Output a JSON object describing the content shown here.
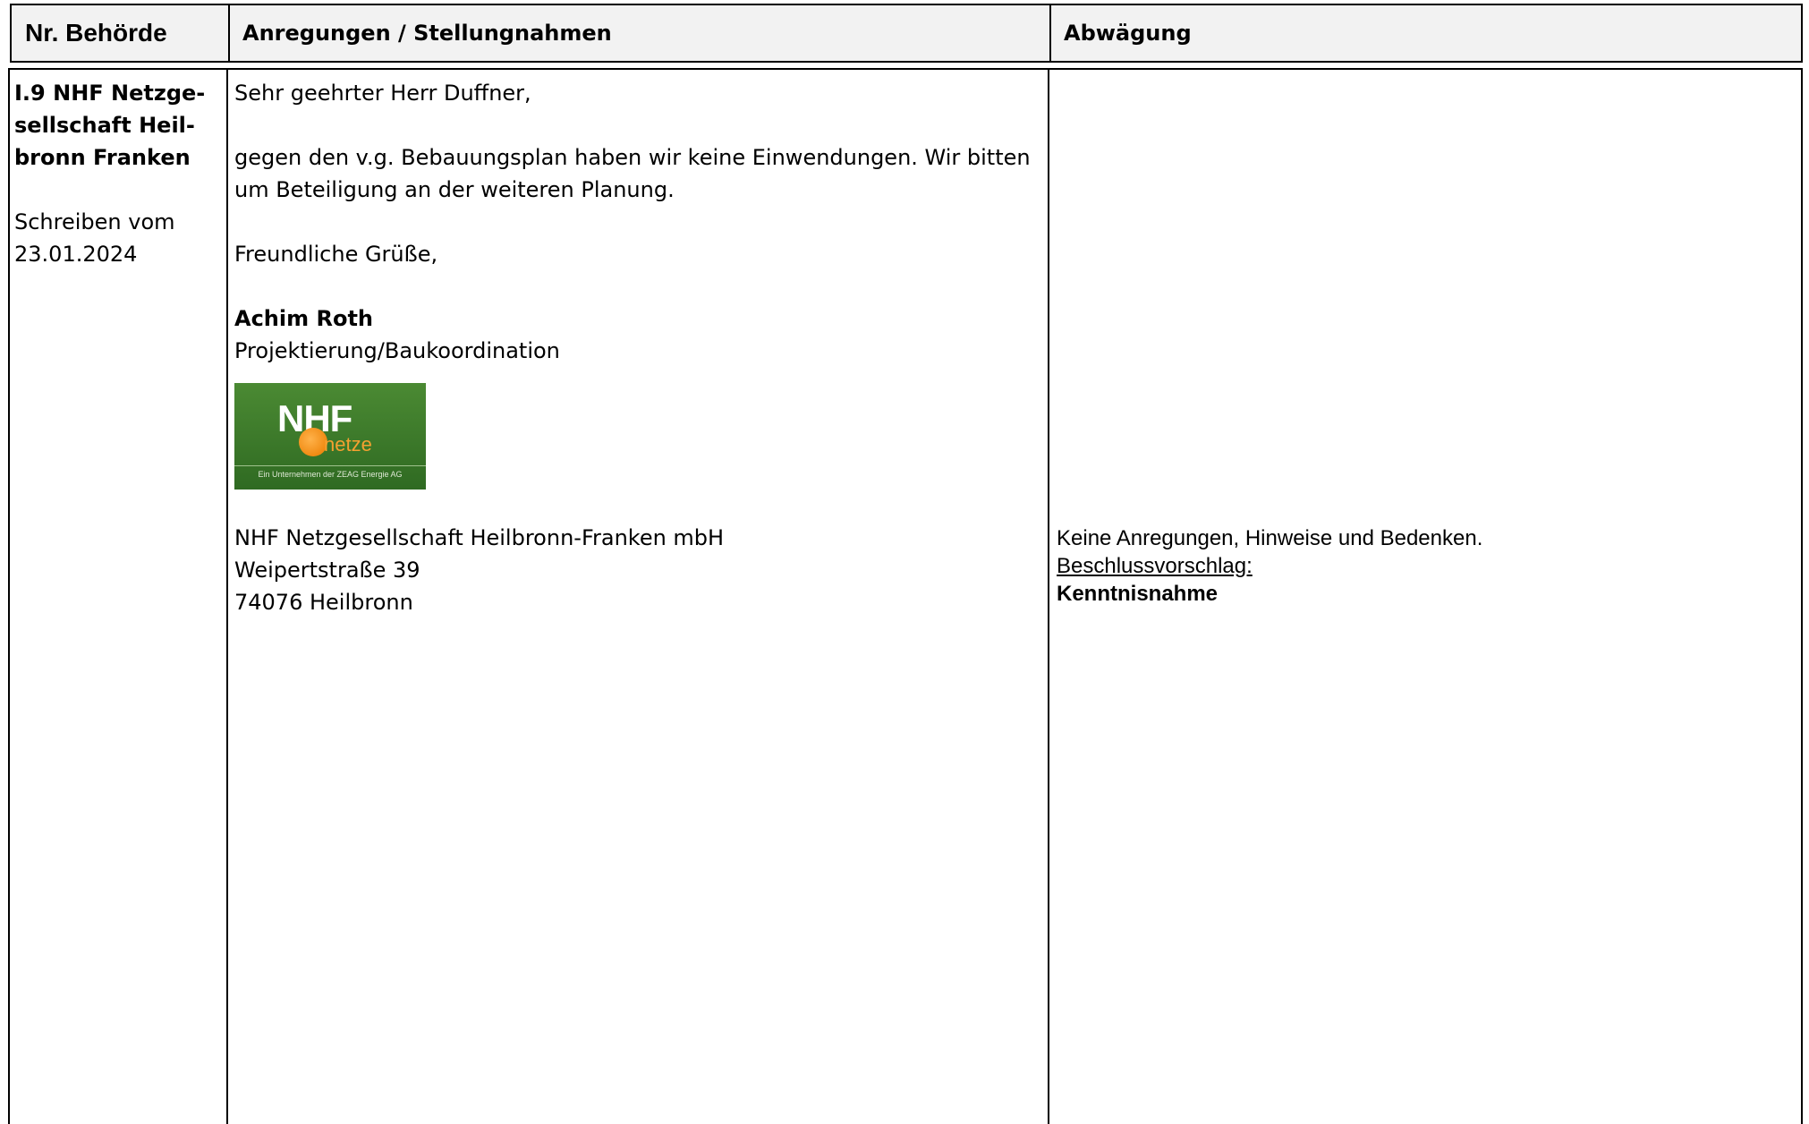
{
  "header": {
    "col1": "Nr. Behörde",
    "col2": "Anregungen / Stellungnahmen",
    "col3": "Abwägung"
  },
  "entry": {
    "authority_lines": [
      "I.9 NHF Netzge-",
      "sellschaft Heil-",
      "bronn Franken"
    ],
    "letter_date_label": "Schreiben vom",
    "letter_date": "23.01.2024"
  },
  "statement": {
    "salutation": "Sehr geehrter Herr Duffner,",
    "body_lines": [
      "gegen den v.g. Bebauungsplan haben wir keine Einwendungen. Wir bitten",
      "um Beteiligung an der weiteren Planung."
    ],
    "closing": "Freundliche Grüße,",
    "signer_name": "Achim Roth",
    "signer_role": "Projektierung/Baukoordination",
    "logo": {
      "wordmark": "NHF",
      "subword": "netze",
      "tagline": "Ein Unternehmen der ZEAG Energie AG",
      "colors": {
        "background": "#3b7a2a",
        "accent": "#f08a12"
      }
    },
    "address_lines": [
      "NHF Netzgesellschaft Heilbronn-Franken mbH",
      "Weipertstraße 39",
      "74076 Heilbronn"
    ]
  },
  "assessment": {
    "text": "Keine Anregungen, Hinweise und Bedenken.",
    "proposal_label": "Beschlussvorschlag:",
    "decision": "Kenntnisnahme"
  }
}
